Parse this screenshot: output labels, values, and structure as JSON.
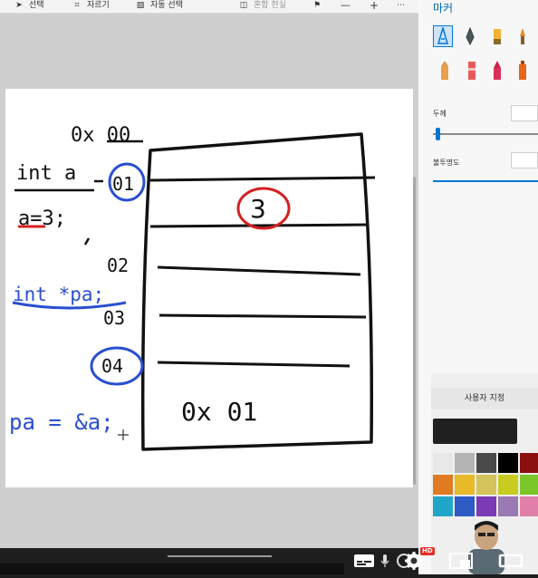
{
  "toolbar": {
    "select_label": "선택",
    "crop_label": "자르기",
    "auto_select_label": "자동 선택",
    "mixed_reality_label": "혼합 현실"
  },
  "panel": {
    "title": "마커",
    "thickness_label": "두께",
    "opacity_label": "불투명도",
    "custom_label": "사용자 지정"
  },
  "drawing": {
    "addr_base": "0x 00",
    "addr_01": "01",
    "addr_02": "02",
    "addr_03": "03",
    "addr_04": "04",
    "decl_int_a": "int a",
    "assign_a": "a=3;",
    "decl_int_pa": "int *pa;",
    "assign_pa": "pa = &a;",
    "cell_value": "3",
    "cell_pointer_value": "0x 01"
  },
  "palette": {
    "current": "#1f1f1f",
    "swatches": [
      "#e8e8e8",
      "#b4b4b4",
      "#4a4a4a",
      "#000000",
      "#8b0f0f",
      "#e07b22",
      "#e8b928",
      "#d4c35a",
      "#c9cc20",
      "#7bc629",
      "#21a6c9",
      "#2f5cc4",
      "#7a3bb5",
      "#9a7ab5",
      "#e07fa7"
    ]
  }
}
